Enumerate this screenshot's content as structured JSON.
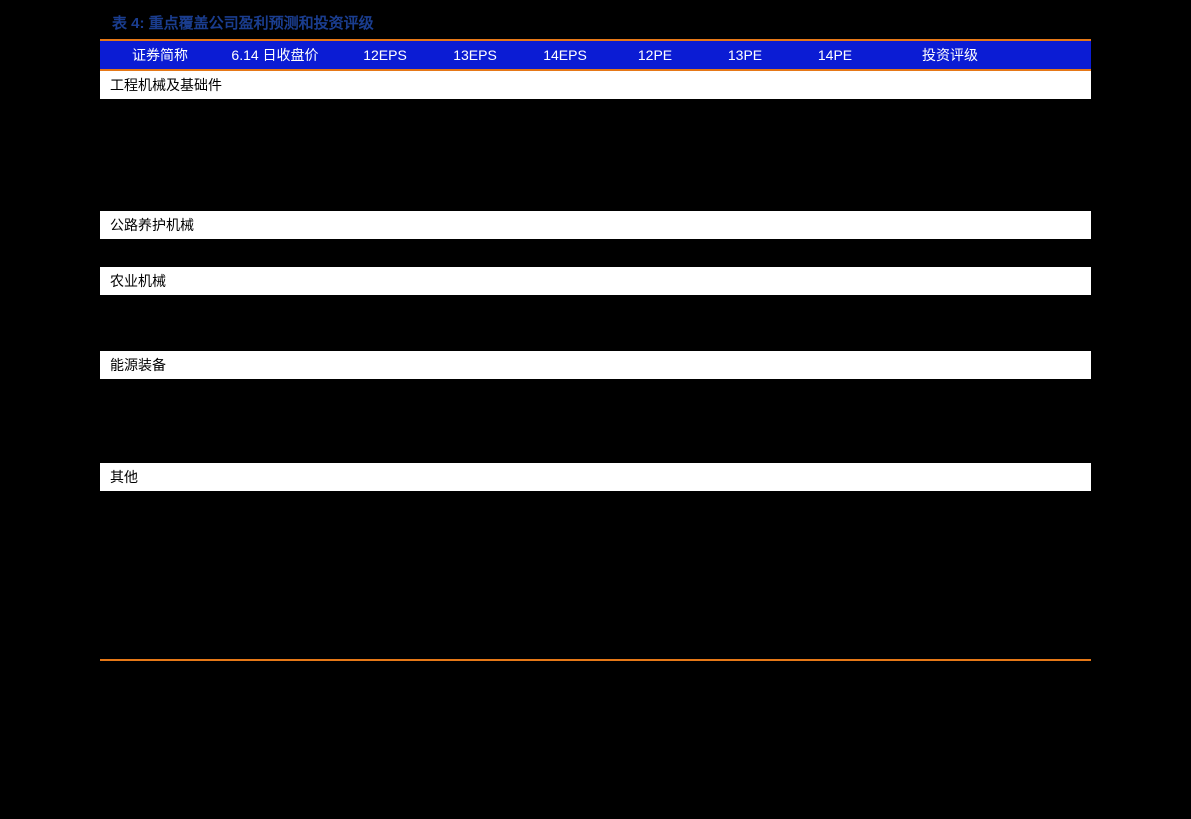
{
  "title": "表 4: 重点覆盖公司盈利预测和投资评级",
  "headers": {
    "name": "证券简称",
    "close": "6.14 日收盘价",
    "eps12": "12EPS",
    "eps13": "13EPS",
    "eps14": "14EPS",
    "pe12": "12PE",
    "pe13": "13PE",
    "pe14": "14PE",
    "rating": "投资评级"
  },
  "sections": [
    {
      "label": "工程机械及基础件",
      "rows_after": 4
    },
    {
      "label": "公路养护机械",
      "rows_after": 1
    },
    {
      "label": "农业机械",
      "rows_after": 2
    },
    {
      "label": "能源装备",
      "rows_after": 3
    },
    {
      "label": "其他",
      "rows_after": 6
    }
  ]
}
